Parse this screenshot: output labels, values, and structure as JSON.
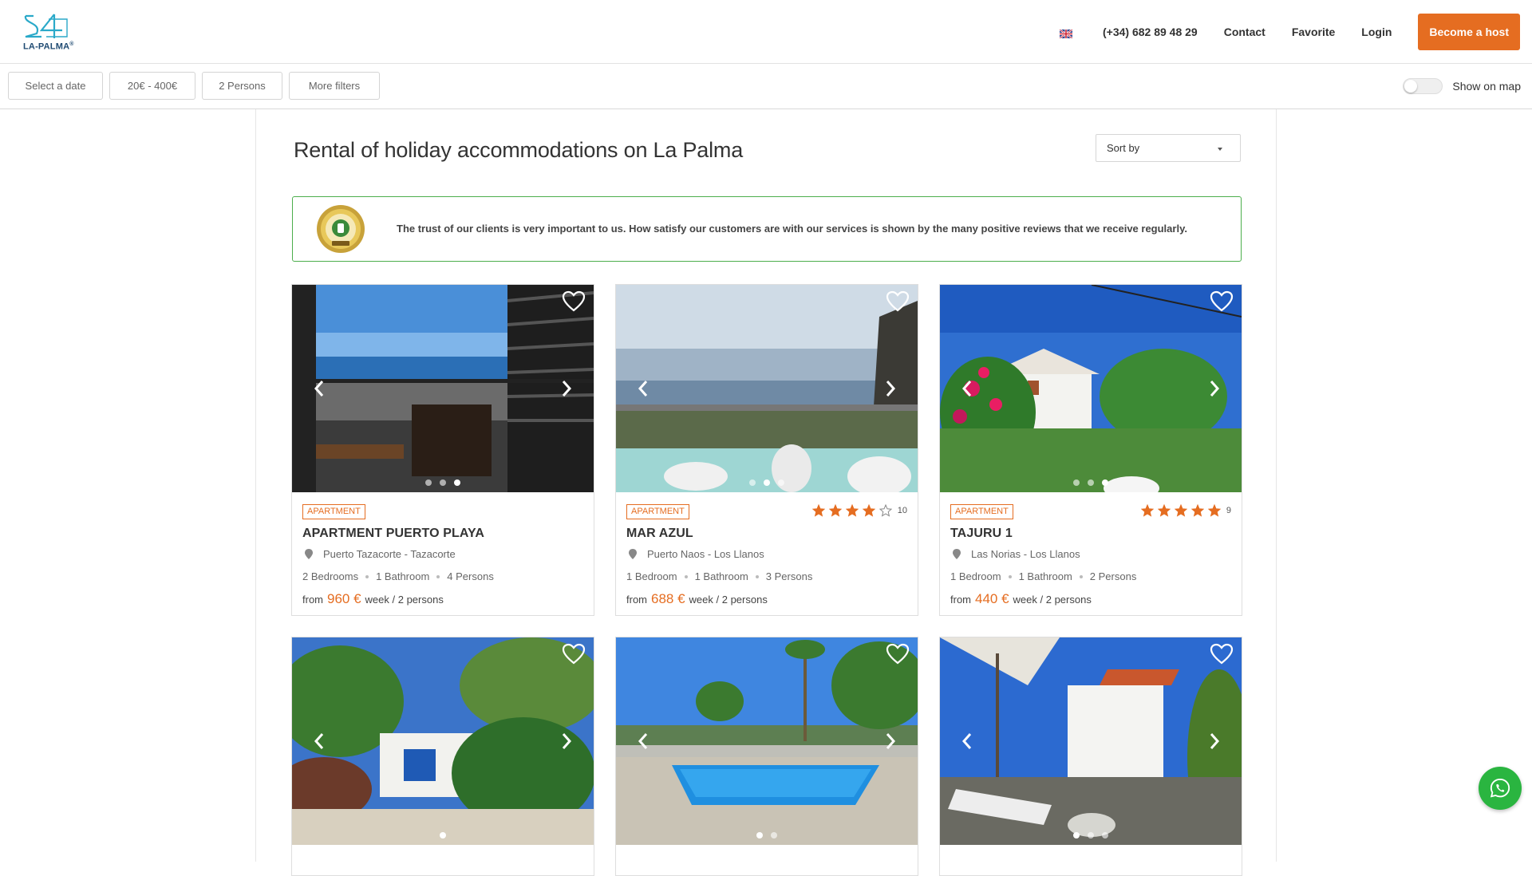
{
  "header": {
    "logo_text": "LA-PALMA",
    "logo_registered": "®",
    "language_icon": "uk-flag-icon",
    "phone": "(+34) 682 89 48 29",
    "contact": "Contact",
    "favorite": "Favorite",
    "login": "Login",
    "become_host": "Become a host",
    "accent_color": "#e56d21"
  },
  "filters": {
    "date": "Select a date",
    "price": "20€ - 400€",
    "persons": "2 Persons",
    "more": "More filters",
    "show_on_map": "Show on map",
    "show_on_map_enabled": false
  },
  "main": {
    "title": "Rental of holiday accommodations on La Palma",
    "sort_label": "Sort by",
    "trust_text": "The trust of our clients is very important to us. How satisfy our customers are with our services is shown by the many positive reviews that we receive regularly.",
    "trust_seal_icon": "ekomi-seal-icon",
    "trust_border_color": "#4cae4c"
  },
  "listings": [
    {
      "type": "APARTMENT",
      "title": "APARTMENT PUERTO PLAYA",
      "location": "Puerto Tazacorte - Tazacorte",
      "bedrooms": "2 Bedrooms",
      "bathrooms": "1 Bathroom",
      "persons": "4 Persons",
      "from": "from",
      "price": "960 €",
      "period": "week / 2 persons",
      "rating": null,
      "reviews": "",
      "dots": 3,
      "active_dot": 2
    },
    {
      "type": "APARTMENT",
      "title": "MAR AZUL",
      "location": "Puerto Naos - Los Llanos",
      "bedrooms": "1 Bedroom",
      "bathrooms": "1 Bathroom",
      "persons": "3 Persons",
      "from": "from",
      "price": "688 €",
      "period": "week / 2 persons",
      "rating": 4,
      "reviews": "10",
      "dots": 3,
      "active_dot": 1
    },
    {
      "type": "APARTMENT",
      "title": "TAJURU 1",
      "location": "Las Norias - Los Llanos",
      "bedrooms": "1 Bedroom",
      "bathrooms": "1 Bathroom",
      "persons": "2 Persons",
      "from": "from",
      "price": "440 €",
      "period": "week / 2 persons",
      "rating": 5,
      "reviews": "9",
      "dots": 3,
      "active_dot": 2
    },
    {
      "dots": 1,
      "active_dot": 0
    },
    {
      "dots": 2,
      "active_dot": 0
    },
    {
      "dots": 3,
      "active_dot": 0
    }
  ]
}
